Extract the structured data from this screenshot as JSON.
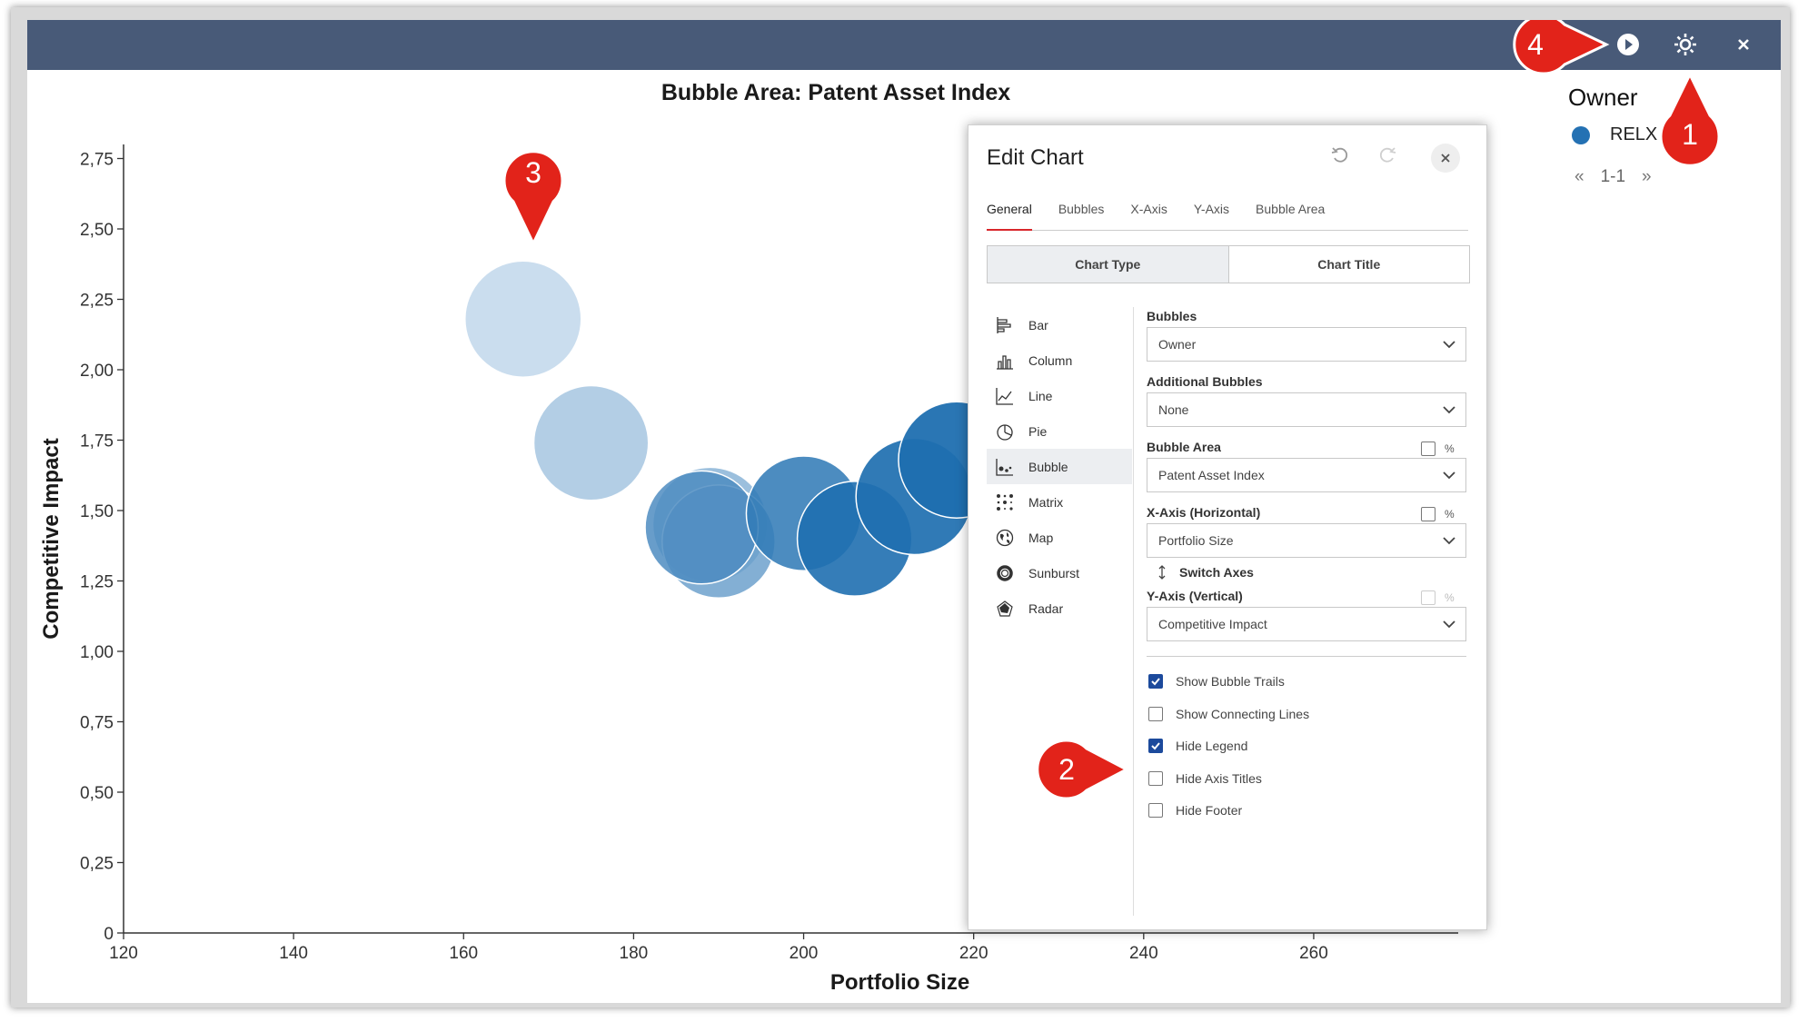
{
  "chart_title": "Bubble Area:  Patent Asset Index",
  "icons": {
    "play": "play-icon",
    "settings": "gear-icon",
    "close": "close-icon"
  },
  "colors": {
    "topbar": "#485a78",
    "bubble_dark": "#1f6fb0",
    "bubble_light": "#b8d1e8",
    "accent_red": "#d9262b",
    "callout_red": "#e2231a",
    "checkbox_blue": "#1c4a9c"
  },
  "callouts": [
    "1",
    "2",
    "3",
    "4"
  ],
  "legend": {
    "title": "Owner",
    "items": [
      {
        "label": "RELX",
        "color": "#2471b3"
      }
    ],
    "pager": {
      "prev": "«",
      "range": "1-1",
      "next": "»"
    }
  },
  "chart_data": {
    "type": "scatter",
    "title": "Bubble Area:  Patent Asset Index",
    "xlabel": "Portfolio Size",
    "ylabel": "Competitive Impact",
    "xlim": [
      120,
      277
    ],
    "ylim": [
      0,
      2.8
    ],
    "x_ticks": [
      "120",
      "140",
      "160",
      "180",
      "200",
      "220",
      "240",
      "260"
    ],
    "y_ticks": [
      "0",
      "0,25",
      "0,50",
      "0,75",
      "1,00",
      "1,25",
      "1,50",
      "1,75",
      "2,00",
      "2,25",
      "2,50",
      "2,75"
    ],
    "series": [
      {
        "name": "RELX",
        "points": [
          {
            "x": 167,
            "y": 2.18,
            "size": 1.0
          },
          {
            "x": 175,
            "y": 1.74,
            "size": 0.9
          },
          {
            "x": 189,
            "y": 1.45,
            "size": 0.9
          },
          {
            "x": 190,
            "y": 1.39,
            "size": 0.8
          },
          {
            "x": 188,
            "y": 1.44,
            "size": 0.8
          },
          {
            "x": 200,
            "y": 1.49,
            "size": 0.9
          },
          {
            "x": 206,
            "y": 1.4,
            "size": 0.9
          },
          {
            "x": 213,
            "y": 1.55,
            "size": 1.0
          },
          {
            "x": 218,
            "y": 1.68,
            "size": 1.0
          }
        ]
      }
    ],
    "grid": false,
    "legend": "right"
  },
  "edit_chart": {
    "title": "Edit Chart",
    "undo_icon": "undo-icon",
    "redo_icon": "redo-icon",
    "tabs": [
      "General",
      "Bubbles",
      "X-Axis",
      "Y-Axis",
      "Bubble Area"
    ],
    "segments": [
      "Chart Type",
      "Chart Title"
    ],
    "chart_types": [
      "Bar",
      "Column",
      "Line",
      "Pie",
      "Bubble",
      "Matrix",
      "Map",
      "Sunburst",
      "Radar"
    ],
    "selected_type": "Bubble",
    "bubbles_label": "Bubbles",
    "bubbles_value": "Owner",
    "additional_label": "Additional Bubbles",
    "additional_value": "None",
    "area_label": "Bubble Area",
    "area_value": "Patent Asset Index",
    "x_label": "X-Axis (Horizontal)",
    "x_value": "Portfolio Size",
    "switch_axes": "Switch Axes",
    "y_label": "Y-Axis (Vertical)",
    "y_value": "Competitive Impact",
    "percent_symbol": "%",
    "options": [
      {
        "label": "Show Bubble Trails",
        "checked": true
      },
      {
        "label": "Show Connecting Lines",
        "checked": false
      },
      {
        "label": "Hide Legend",
        "checked": true
      },
      {
        "label": "Hide Axis Titles",
        "checked": false
      },
      {
        "label": "Hide Footer",
        "checked": false
      }
    ]
  }
}
